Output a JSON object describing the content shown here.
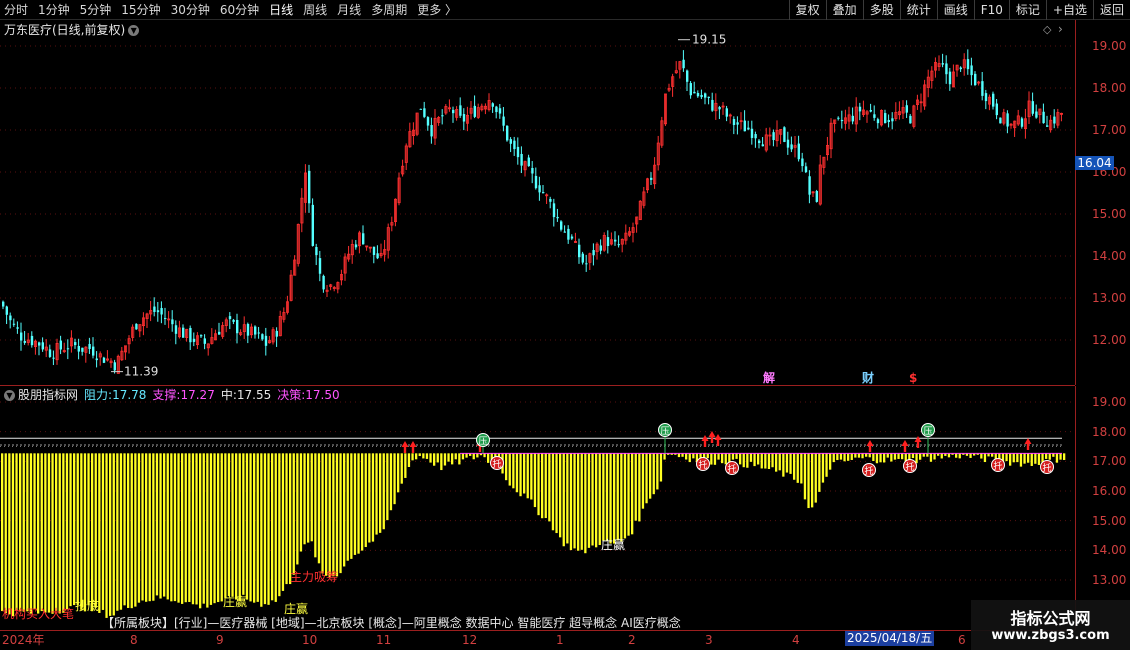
{
  "toolbar": {
    "period_tabs": [
      "分时",
      "1分钟",
      "5分钟",
      "15分钟",
      "30分钟",
      "60分钟",
      "日线",
      "周线",
      "月线",
      "多周期",
      "更多 〉"
    ],
    "active_tab": "日线",
    "right_tools": [
      "复权",
      "叠加",
      "多股",
      "统计",
      "画线",
      "F10",
      "标记",
      "+自选",
      "返回"
    ]
  },
  "main_chart": {
    "title": "万东医疗(日线,前复权)",
    "y_axis_labels": [
      "19.00",
      "18.00",
      "17.00",
      "16.00",
      "15.00",
      "14.00",
      "13.00",
      "12.00"
    ],
    "current_price": "16.04",
    "high_marker": "19.15",
    "low_marker": "11.39",
    "event_markers": [
      "解",
      "财",
      "$"
    ]
  },
  "indicator": {
    "name": "股朋指标网",
    "resistance_label": "阻力:",
    "resistance": "17.78",
    "support_label": "支撑:",
    "support": "17.27",
    "mid_label": "中:",
    "mid": "17.55",
    "decision_label": "决策:",
    "decision": "17.50",
    "y_axis_labels": [
      "19.00",
      "18.00",
      "17.00",
      "16.00",
      "15.00",
      "14.00",
      "13.00"
    ],
    "annotations": {
      "inst_buy": "机构买入大笔",
      "main_force": "主力吸筹",
      "zhuang_win": "庄赢",
      "zhuang_win2": "庄赢",
      "zhuang_win3": "庄赢",
      "bottom": "抄底"
    },
    "badges": {
      "up": "压",
      "down": "托"
    }
  },
  "sector_text": "【所属板块】[行业]—医疗器械 [地域]—北京板块 [概念]—阿里概念 数据中心 智能医疗 超导概念 AI医疗概念",
  "date_axis": {
    "labels": [
      "2024年",
      "8",
      "9",
      "10",
      "11",
      "12",
      "1",
      "2",
      "3",
      "4",
      "6"
    ],
    "cursor_date": "2025/04/18/五"
  },
  "watermark": {
    "title": "指标公式网",
    "url": "www.zbgs3.com"
  },
  "chart_data": {
    "type": "candlestick",
    "title": "万东医疗(日线,前复权)",
    "x_start_label": "2024年",
    "month_labels": [
      "8",
      "9",
      "10",
      "11",
      "12",
      "1",
      "2",
      "3",
      "4",
      "6"
    ],
    "close_path": [
      [
        0,
        12.9
      ],
      [
        10,
        12.4
      ],
      [
        20,
        12.1
      ],
      [
        30,
        12.0
      ],
      [
        40,
        11.9
      ],
      [
        50,
        11.7
      ],
      [
        60,
        11.8
      ],
      [
        70,
        11.9
      ],
      [
        80,
        11.8
      ],
      [
        90,
        11.8
      ],
      [
        100,
        11.6
      ],
      [
        110,
        11.5
      ],
      [
        115,
        11.4
      ],
      [
        125,
        11.9
      ],
      [
        135,
        12.4
      ],
      [
        145,
        12.6
      ],
      [
        155,
        12.7
      ],
      [
        165,
        12.5
      ],
      [
        175,
        12.3
      ],
      [
        185,
        12.1
      ],
      [
        195,
        12.0
      ],
      [
        205,
        11.9
      ],
      [
        215,
        12.2
      ],
      [
        225,
        12.4
      ],
      [
        235,
        12.3
      ],
      [
        245,
        12.2
      ],
      [
        255,
        12.1
      ],
      [
        265,
        11.9
      ],
      [
        275,
        12.2
      ],
      [
        285,
        12.8
      ],
      [
        292,
        13.8
      ],
      [
        300,
        15.2
      ],
      [
        304,
        16.2
      ],
      [
        310,
        14.6
      ],
      [
        320,
        13.4
      ],
      [
        330,
        13.3
      ],
      [
        340,
        13.6
      ],
      [
        350,
        14.2
      ],
      [
        360,
        14.5
      ],
      [
        370,
        14.1
      ],
      [
        380,
        13.9
      ],
      [
        390,
        14.8
      ],
      [
        398,
        15.9
      ],
      [
        405,
        16.7
      ],
      [
        412,
        17.1
      ],
      [
        420,
        17.6
      ],
      [
        430,
        17.0
      ],
      [
        440,
        17.3
      ],
      [
        450,
        17.5
      ],
      [
        460,
        17.2
      ],
      [
        470,
        17.4
      ],
      [
        480,
        17.6
      ],
      [
        490,
        17.8
      ],
      [
        500,
        17.2
      ],
      [
        510,
        16.6
      ],
      [
        520,
        16.2
      ],
      [
        530,
        15.9
      ],
      [
        540,
        15.6
      ],
      [
        550,
        15.2
      ],
      [
        560,
        14.7
      ],
      [
        570,
        14.4
      ],
      [
        580,
        13.9
      ],
      [
        585,
        13.8
      ],
      [
        595,
        14.2
      ],
      [
        605,
        14.4
      ],
      [
        615,
        14.2
      ],
      [
        625,
        14.4
      ],
      [
        635,
        14.8
      ],
      [
        645,
        15.6
      ],
      [
        652,
        16.0
      ],
      [
        660,
        17.2
      ],
      [
        665,
        17.9
      ],
      [
        672,
        18.3
      ],
      [
        680,
        18.6
      ],
      [
        685,
        18.2
      ],
      [
        690,
        17.9
      ],
      [
        700,
        17.8
      ],
      [
        710,
        17.6
      ],
      [
        720,
        17.5
      ],
      [
        730,
        17.2
      ],
      [
        740,
        17.1
      ],
      [
        750,
        17.0
      ],
      [
        760,
        16.8
      ],
      [
        770,
        16.7
      ],
      [
        780,
        16.9
      ],
      [
        790,
        16.6
      ],
      [
        800,
        16.4
      ],
      [
        808,
        15.5
      ],
      [
        815,
        15.3
      ],
      [
        820,
        16.2
      ],
      [
        830,
        17.0
      ],
      [
        840,
        17.2
      ],
      [
        850,
        17.3
      ],
      [
        860,
        17.5
      ],
      [
        870,
        17.4
      ],
      [
        880,
        17.3
      ],
      [
        890,
        17.3
      ],
      [
        900,
        17.4
      ],
      [
        910,
        17.3
      ],
      [
        920,
        17.8
      ],
      [
        930,
        18.4
      ],
      [
        940,
        18.5
      ],
      [
        950,
        18.2
      ],
      [
        960,
        18.6
      ],
      [
        970,
        18.3
      ],
      [
        980,
        18.0
      ],
      [
        990,
        17.7
      ],
      [
        1000,
        17.3
      ],
      [
        1010,
        17.1
      ],
      [
        1020,
        17.2
      ],
      [
        1030,
        17.6
      ],
      [
        1040,
        17.3
      ],
      [
        1050,
        17.2
      ],
      [
        1060,
        17.4
      ]
    ],
    "y_range": [
      11.0,
      19.6
    ],
    "high": 19.15,
    "low": 11.39,
    "last": 16.04,
    "indicator_lines": {
      "resistance": 17.78,
      "support": 17.27,
      "mid": 17.55,
      "decision": 17.5
    },
    "indicator_y_range": [
      12.5,
      19.4
    ],
    "bar_bottom_path": [
      [
        0,
        11.9
      ],
      [
        40,
        11.9
      ],
      [
        60,
        12.0
      ],
      [
        80,
        12.1
      ],
      [
        100,
        11.9
      ],
      [
        110,
        11.8
      ],
      [
        120,
        12.0
      ],
      [
        140,
        12.3
      ],
      [
        160,
        12.4
      ],
      [
        180,
        12.3
      ],
      [
        200,
        12.1
      ],
      [
        220,
        12.3
      ],
      [
        240,
        12.4
      ],
      [
        260,
        12.2
      ],
      [
        275,
        12.3
      ],
      [
        290,
        13.0
      ],
      [
        300,
        14.0
      ],
      [
        310,
        14.3
      ],
      [
        320,
        13.2
      ],
      [
        330,
        13.1
      ],
      [
        340,
        13.3
      ],
      [
        350,
        13.8
      ],
      [
        360,
        14.0
      ],
      [
        370,
        14.3
      ],
      [
        380,
        14.5
      ],
      [
        390,
        15.3
      ],
      [
        400,
        16.2
      ],
      [
        410,
        17.0
      ],
      [
        420,
        17.2
      ],
      [
        440,
        16.8
      ],
      [
        460,
        17.0
      ],
      [
        480,
        17.2
      ],
      [
        500,
        16.7
      ],
      [
        510,
        16.2
      ],
      [
        520,
        15.9
      ],
      [
        530,
        15.6
      ],
      [
        540,
        15.2
      ],
      [
        550,
        14.9
      ],
      [
        560,
        14.3
      ],
      [
        570,
        14.1
      ],
      [
        580,
        13.9
      ],
      [
        590,
        14.1
      ],
      [
        600,
        14.3
      ],
      [
        610,
        14.2
      ],
      [
        620,
        14.3
      ],
      [
        630,
        14.6
      ],
      [
        640,
        15.2
      ],
      [
        650,
        15.9
      ],
      [
        658,
        16.1
      ],
      [
        665,
        17.3
      ],
      [
        700,
        17.0
      ],
      [
        730,
        17.0
      ],
      [
        760,
        16.8
      ],
      [
        780,
        16.6
      ],
      [
        800,
        16.3
      ],
      [
        808,
        15.3
      ],
      [
        815,
        15.6
      ],
      [
        830,
        16.9
      ],
      [
        860,
        17.1
      ],
      [
        900,
        17.0
      ],
      [
        960,
        17.2
      ],
      [
        1000,
        17.0
      ],
      [
        1030,
        16.9
      ],
      [
        1060,
        17.1
      ],
      [
        1075,
        17.2
      ]
    ]
  }
}
